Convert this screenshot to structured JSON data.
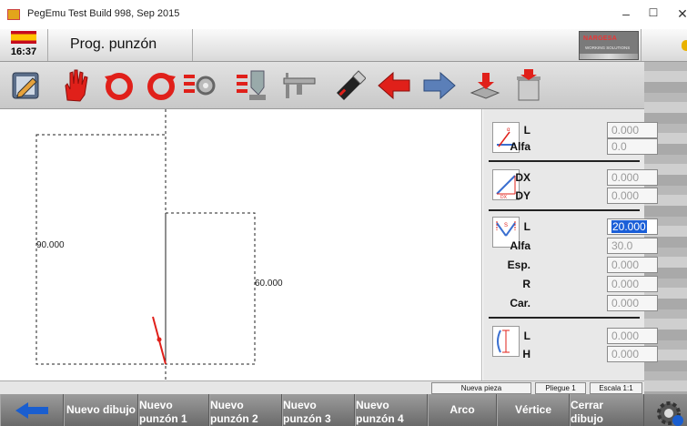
{
  "window": {
    "title": "PegEmu Test Build 998, Sep 2015",
    "minimize_glyph": "–",
    "maximize_glyph": "☐",
    "close_glyph": "✕"
  },
  "header": {
    "time": "16:37",
    "screen_title": "Prog. punzón",
    "brand_name": "NARGESA",
    "brand_tagline": "WORKING SOLUTIONS"
  },
  "toolbar": {
    "icons": [
      "pencil-icon",
      "stop-hand-icon",
      "rotate-left-icon",
      "rotate-right-icon",
      "settings-list-icon",
      "tool-list-icon",
      "caliper-icon",
      "usb-icon",
      "arrow-left-icon",
      "arrow-right-icon",
      "save-icon",
      "trash-icon"
    ]
  },
  "drawing": {
    "dim_left": "90.000",
    "dim_right": "60.000"
  },
  "params": {
    "g1": {
      "l_label": "L",
      "l_value": "0.000",
      "alfa_label": "Alfa",
      "alfa_value": "0.0"
    },
    "g2": {
      "dx_label": "DX",
      "dx_value": "0.000",
      "dy_label": "DY",
      "dy_value": "0.000"
    },
    "g3": {
      "l_label": "L",
      "l_value": "20.000",
      "alfa_label": "Alfa",
      "alfa_value": "30.0",
      "esp_label": "Esp.",
      "esp_value": "0.000",
      "r_label": "R",
      "r_value": "0.000",
      "car_label": "Car.",
      "car_value": "0.000"
    },
    "g4": {
      "l_label": "L",
      "l_value": "0.000",
      "h_label": "H",
      "h_value": "0.000"
    }
  },
  "status": {
    "piece": "Nueva pieza",
    "bend": "Pliegue 1",
    "scale": "Escala 1:1"
  },
  "buttons": {
    "nuevo_dibujo": "Nuevo dibujo",
    "nuevo_p1_a": "Nuevo",
    "nuevo_p1_b": "punzón 1",
    "nuevo_p2_a": "Nuevo",
    "nuevo_p2_b": "punzón 2",
    "nuevo_p3_a": "Nuevo",
    "nuevo_p3_b": "punzón 3",
    "nuevo_p4_a": "Nuevo",
    "nuevo_p4_b": "punzón 4",
    "arco": "Arco",
    "vertice": "Vértice",
    "cerrar_a": "Cerrar",
    "cerrar_b": "dibujo"
  },
  "colors": {
    "accent_red": "#e0201a",
    "accent_blue": "#3a6fd0",
    "selection_blue": "#1b5fd8"
  }
}
